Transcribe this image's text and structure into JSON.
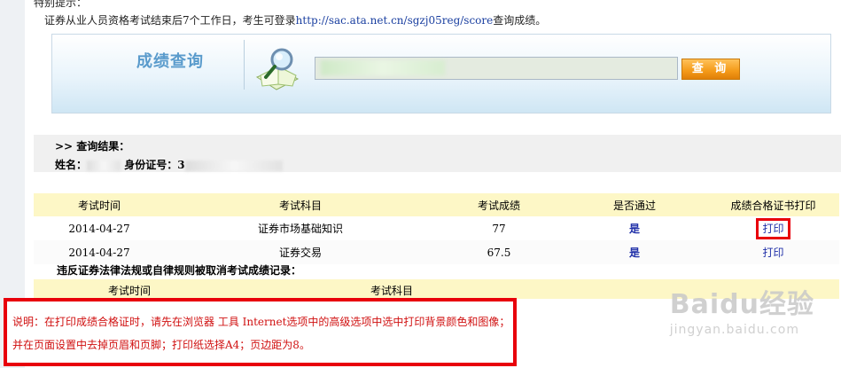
{
  "tip": {
    "title": "特别提示：",
    "line_prefix": "证券从业人员资格考试结束后7个工作日，考生可登录",
    "link": "http://sac.ata.net.cn/sgzj05reg/score",
    "line_suffix": "查询成绩。"
  },
  "search": {
    "title": "成绩查询",
    "input_value": "",
    "button": "查 询"
  },
  "result": {
    "header": ">> 查询结果：",
    "name_label": "姓名：",
    "id_label": "身份证号：",
    "id_prefix": "3"
  },
  "scores": {
    "columns": [
      "考试时间",
      "考试科目",
      "考试成绩",
      "是否通过",
      "成绩合格证书打印"
    ],
    "rows": [
      {
        "date": "2014-04-27",
        "subject": "证券市场基础知识",
        "score": "77",
        "passed": "是",
        "print": "打印"
      },
      {
        "date": "2014-04-27",
        "subject": "证券交易",
        "score": "67.5",
        "passed": "是",
        "print": "打印"
      }
    ]
  },
  "violations": {
    "title": "违反证券法律法规或自律规则被取消考试成绩记录：",
    "columns": [
      "考试时间",
      "考试科目"
    ]
  },
  "notice": {
    "line1": "说明：在打印成绩合格证时，请先在浏览器 工具 Internet选项中的高级选项中选中打印背景颜色和图像；",
    "line2": "并在页面设置中去掉页眉和页脚；打印纸选择A4；页边距为8。"
  },
  "watermark": {
    "logo": "Baidu经验",
    "url": "jingyan.baidu.com"
  },
  "colors": {
    "highlight": "#e8000b",
    "link": "#1f2fa8",
    "table_header": "#fdf7c6",
    "button": "#f49a18",
    "title_blue": "#5a9bcc"
  }
}
